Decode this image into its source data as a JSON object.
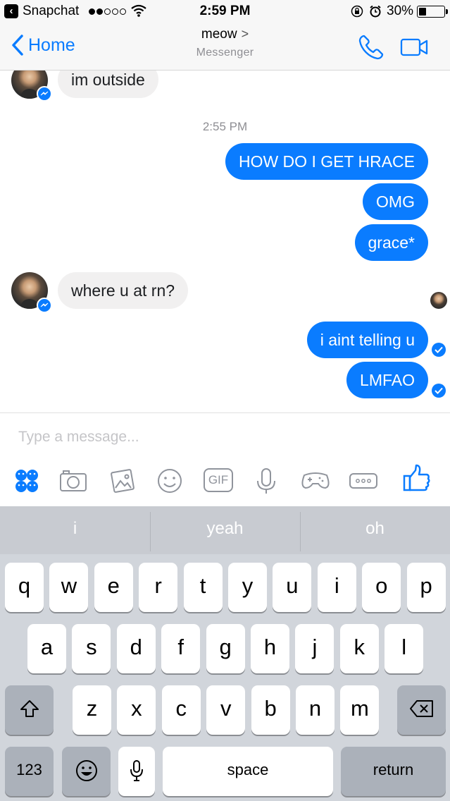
{
  "status_bar": {
    "back_app": "Snapchat",
    "time": "2:59 PM",
    "battery": "30%",
    "battery_level": 0.3,
    "signal_bars": [
      true,
      true,
      false,
      false,
      false
    ]
  },
  "nav": {
    "back_label": "Home",
    "title": "meow",
    "title_chevron": ">",
    "subtitle": "Messenger"
  },
  "messages": [
    {
      "text": "im outside",
      "dir": "in"
    },
    {
      "text": "2:55 PM",
      "dir": "timestamp"
    },
    {
      "text": "HOW DO I GET HRACE",
      "dir": "out"
    },
    {
      "text": "OMG",
      "dir": "out"
    },
    {
      "text": "grace*",
      "dir": "out"
    },
    {
      "text": "where u at rn?",
      "dir": "in"
    },
    {
      "text": "i aint telling u",
      "dir": "out"
    },
    {
      "text": "LMFAO",
      "dir": "out"
    }
  ],
  "composer": {
    "placeholder": "Type a message...",
    "tools": [
      "emoji-faces-icon",
      "camera-icon",
      "gallery-icon",
      "sticker-smile-icon",
      "gif-icon",
      "microphone-icon",
      "games-icon",
      "more-icon",
      "like-icon"
    ],
    "gif_label": "GIF"
  },
  "keyboard": {
    "suggestions": [
      "i",
      "yeah",
      "oh"
    ],
    "row1": [
      "q",
      "w",
      "e",
      "r",
      "t",
      "y",
      "u",
      "i",
      "o",
      "p"
    ],
    "row2": [
      "a",
      "s",
      "d",
      "f",
      "g",
      "h",
      "j",
      "k",
      "l"
    ],
    "row3": [
      "z",
      "x",
      "c",
      "v",
      "b",
      "n",
      "m"
    ],
    "numbers_label": "123",
    "space_label": "space",
    "return_label": "return"
  },
  "colors": {
    "accent": "#0a7cff",
    "incoming_bubble": "#f1f0f0",
    "keyboard_bg": "#d1d5db"
  }
}
